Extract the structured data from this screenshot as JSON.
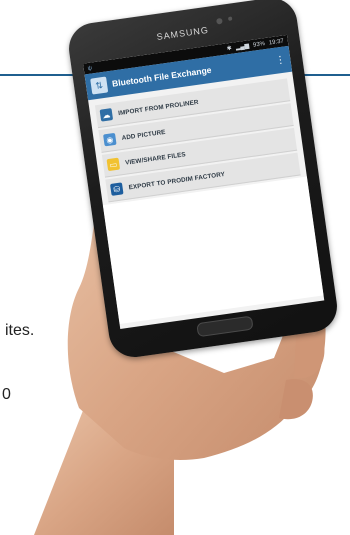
{
  "background": {
    "partial_text_top": "ites.",
    "partial_text_bottom": "0"
  },
  "phone": {
    "brand": "SAMSUNG",
    "status": {
      "time": "19:37",
      "battery": "93%"
    },
    "app": {
      "title": "Bluetooth File Exchange",
      "overflow_icon": "⋮",
      "menu": [
        {
          "label": "IMPORT FROM PROLINER",
          "icon": "upload-cloud-icon"
        },
        {
          "label": "ADD PICTURE",
          "icon": "camera-icon"
        },
        {
          "label": "VIEW/SHARE FILES",
          "icon": "folder-icon"
        },
        {
          "label": "EXPORT TO PRODIM FACTORY",
          "icon": "database-icon"
        }
      ]
    }
  },
  "colors": {
    "action_bar": "#2f6ea5",
    "accent_line": "#1f5f8f"
  }
}
